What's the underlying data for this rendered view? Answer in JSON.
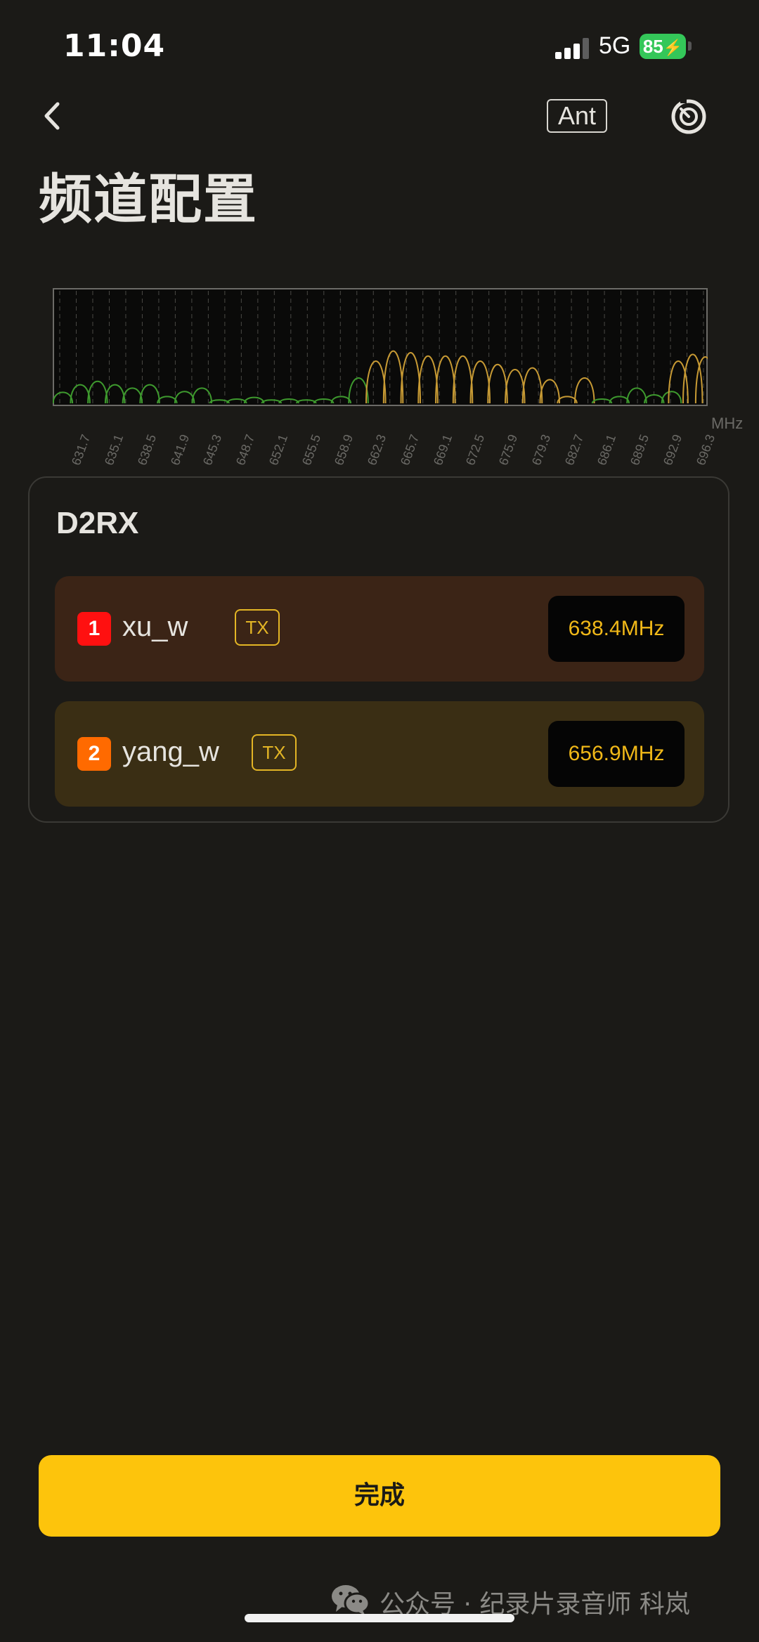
{
  "status_bar": {
    "time": "11:04",
    "network": "5G",
    "battery": "85",
    "signal_bars_active": 3,
    "signal_bars_total": 4
  },
  "header": {
    "back_icon": "chevron-left-icon",
    "ant_label": "Ant",
    "timer_icon": "timer-icon",
    "title": "频道配置"
  },
  "spectrum": {
    "unit": "MHz",
    "ticks": [
      "631.7",
      "635.1",
      "638.5",
      "641.9",
      "645.3",
      "648.7",
      "652.1",
      "655.5",
      "658.9",
      "662.3",
      "665.7",
      "669.1",
      "672.5",
      "675.9",
      "679.3",
      "682.7",
      "686.1",
      "689.5",
      "692.9",
      "696.3"
    ],
    "x_range": [
      630,
      697.5
    ],
    "colors": {
      "low": "#3e9a2e",
      "high": "#c79a34",
      "grid": "#4a4945",
      "border": "#6c6b67"
    },
    "lobes": [
      {
        "f": 630.9,
        "h": 0.13,
        "c": "low"
      },
      {
        "f": 632.7,
        "h": 0.22,
        "c": "low"
      },
      {
        "f": 634.5,
        "h": 0.26,
        "c": "low"
      },
      {
        "f": 636.3,
        "h": 0.22,
        "c": "low"
      },
      {
        "f": 638.1,
        "h": 0.18,
        "c": "low"
      },
      {
        "f": 639.9,
        "h": 0.22,
        "c": "low"
      },
      {
        "f": 641.7,
        "h": 0.08,
        "c": "low"
      },
      {
        "f": 643.5,
        "h": 0.14,
        "c": "low"
      },
      {
        "f": 645.3,
        "h": 0.18,
        "c": "low"
      },
      {
        "f": 647.1,
        "h": 0.04,
        "c": "low"
      },
      {
        "f": 648.9,
        "h": 0.05,
        "c": "low"
      },
      {
        "f": 650.7,
        "h": 0.07,
        "c": "low"
      },
      {
        "f": 652.5,
        "h": 0.04,
        "c": "low"
      },
      {
        "f": 654.3,
        "h": 0.05,
        "c": "low"
      },
      {
        "f": 656.1,
        "h": 0.04,
        "c": "low"
      },
      {
        "f": 657.9,
        "h": 0.05,
        "c": "low"
      },
      {
        "f": 659.7,
        "h": 0.08,
        "c": "low"
      },
      {
        "f": 661.5,
        "h": 0.3,
        "c": "low"
      },
      {
        "f": 663.3,
        "h": 0.5,
        "c": "high"
      },
      {
        "f": 665.1,
        "h": 0.62,
        "c": "high"
      },
      {
        "f": 666.9,
        "h": 0.6,
        "c": "high"
      },
      {
        "f": 668.7,
        "h": 0.56,
        "c": "high"
      },
      {
        "f": 670.5,
        "h": 0.56,
        "c": "high"
      },
      {
        "f": 672.3,
        "h": 0.56,
        "c": "high"
      },
      {
        "f": 674.1,
        "h": 0.5,
        "c": "high"
      },
      {
        "f": 675.9,
        "h": 0.46,
        "c": "high"
      },
      {
        "f": 677.7,
        "h": 0.4,
        "c": "high"
      },
      {
        "f": 679.5,
        "h": 0.42,
        "c": "high"
      },
      {
        "f": 681.3,
        "h": 0.28,
        "c": "high"
      },
      {
        "f": 683.1,
        "h": 0.08,
        "c": "high"
      },
      {
        "f": 684.9,
        "h": 0.3,
        "c": "high"
      },
      {
        "f": 686.7,
        "h": 0.05,
        "c": "low"
      },
      {
        "f": 688.5,
        "h": 0.08,
        "c": "low"
      },
      {
        "f": 690.3,
        "h": 0.18,
        "c": "low"
      },
      {
        "f": 692.1,
        "h": 0.1,
        "c": "low"
      },
      {
        "f": 693.9,
        "h": 0.14,
        "c": "low"
      },
      {
        "f": 694.6,
        "h": 0.5,
        "c": "high"
      },
      {
        "f": 696.1,
        "h": 0.58,
        "c": "high"
      },
      {
        "f": 697.4,
        "h": 0.55,
        "c": "high"
      }
    ]
  },
  "device": {
    "name": "D2RX",
    "channels": [
      {
        "num": "1",
        "name": "xu_w",
        "badge": "TX",
        "freq": "638.4MHz",
        "num_color": "#ff1010"
      },
      {
        "num": "2",
        "name": "yang_w",
        "badge": "TX",
        "freq": "656.9MHz",
        "num_color": "#ff6a00"
      }
    ]
  },
  "done_button": {
    "label": "完成"
  },
  "footer": {
    "watermark_icon": "wechat-icon",
    "watermark": "公众号 · 纪录片录音师 科岚"
  }
}
